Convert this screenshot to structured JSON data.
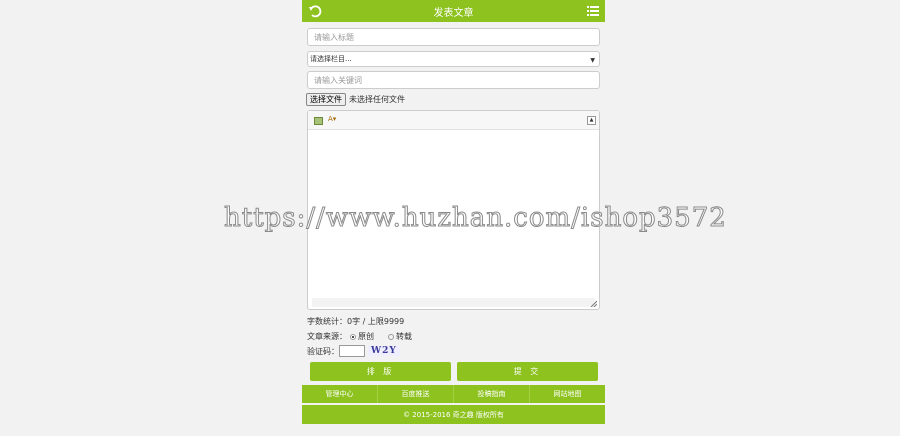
{
  "header": {
    "title": "发表文章",
    "back_icon": "back-arrow-icon",
    "menu_icon": "list-menu-icon"
  },
  "form": {
    "title_placeholder": "请输入标题",
    "category_selected": "请选择栏目...",
    "keyword_placeholder": "请输入关键词",
    "file_button": "选择文件",
    "file_status": "未选择任何文件"
  },
  "editor": {
    "toolbar": {
      "image_icon": "image-icon",
      "font_icon": "font-size-icon",
      "font_label": "A"
    }
  },
  "stats": {
    "word_count": "字数统计：0字 / 上限9999"
  },
  "source": {
    "label": "文章来源：",
    "option_original": "原创",
    "option_repost": "转载",
    "selected": "原创"
  },
  "captcha": {
    "label": "验证码：",
    "code": "W2Y"
  },
  "buttons": {
    "format": "排 版",
    "submit": "提 交"
  },
  "footer": {
    "nav": [
      "管理中心",
      "百度推送",
      "投稿指南",
      "网站地图"
    ],
    "copyright": "© 2015-2016 奇之趣 版权所有"
  },
  "watermark": "https://www.huzhan.com/ishop3572",
  "colors": {
    "accent": "#8dc21f",
    "background": "#f2f2f2"
  }
}
